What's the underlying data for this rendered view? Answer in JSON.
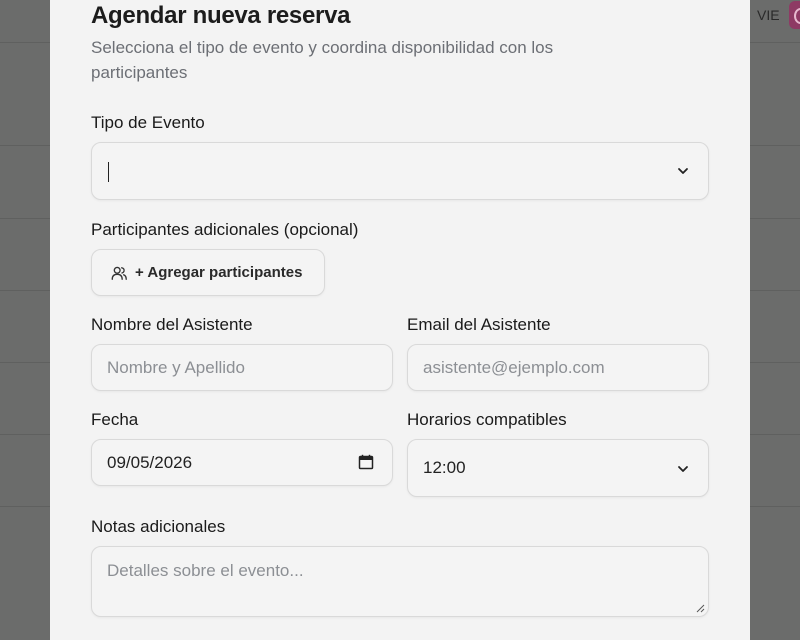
{
  "background": {
    "day_label": "VIE"
  },
  "modal": {
    "title": "Agendar nueva reserva",
    "subtitle": "Selecciona el tipo de evento y coordina disponibilidad con los participantes",
    "event_type": {
      "label": "Tipo de Evento",
      "value": ""
    },
    "participants": {
      "label": "Participantes adicionales (opcional)",
      "button_label": "+ Agregar participantes"
    },
    "attendee_name": {
      "label": "Nombre del Asistente",
      "placeholder": "Nombre y Apellido",
      "value": ""
    },
    "attendee_email": {
      "label": "Email del Asistente",
      "placeholder": "asistente@ejemplo.com",
      "value": ""
    },
    "date": {
      "label": "Fecha",
      "value": "09/05/2026"
    },
    "time": {
      "label": "Horarios compatibles",
      "value": "12:00"
    },
    "notes": {
      "label": "Notas adicionales",
      "placeholder": "Detalles sobre el evento...",
      "value": ""
    }
  },
  "colors": {
    "overlay": "#6b6c6b",
    "modal_bg": "#f3f3f3",
    "avatar": "#8e3a64"
  },
  "icons": {
    "select_chevron": "chevron-down-icon",
    "participants": "users-icon",
    "date": "calendar-icon"
  }
}
